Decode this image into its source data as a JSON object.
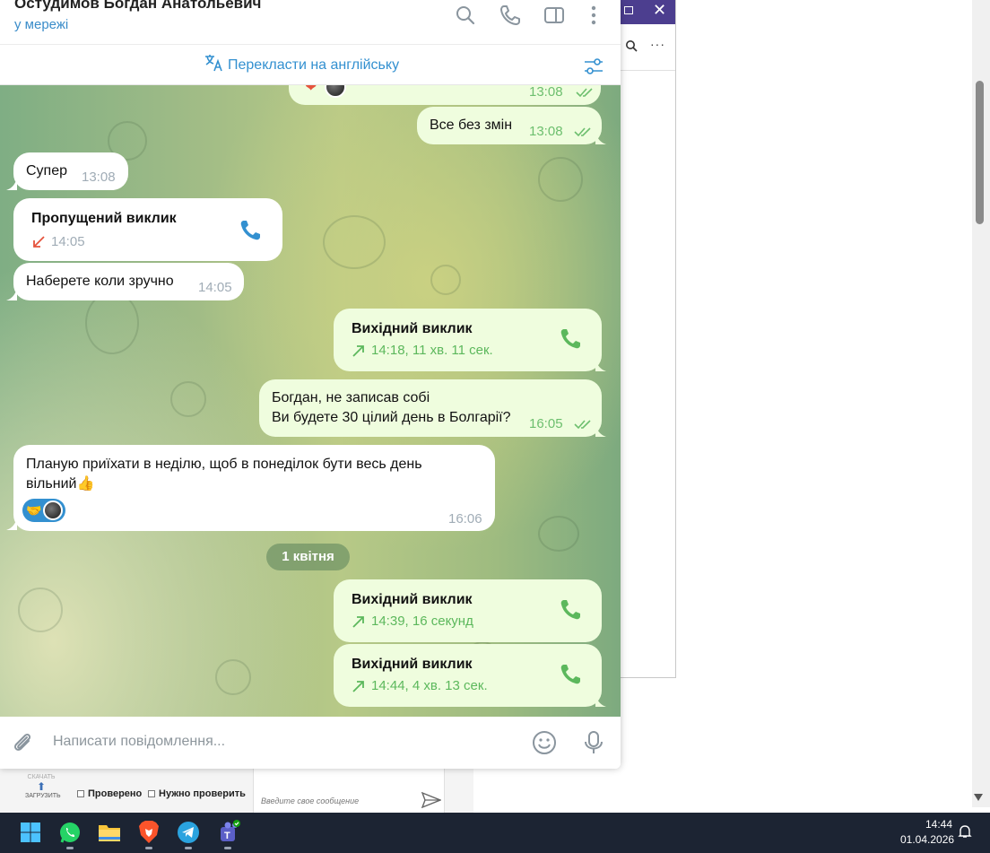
{
  "header": {
    "contact_name": "Остудимов Богдан Анатольевич",
    "status": "у мережі",
    "icons": [
      "search-icon",
      "phone-icon",
      "sidebar-toggle-icon",
      "more-vertical-icon"
    ]
  },
  "translate_bar": {
    "label": "Перекласти на англійську",
    "icon": "translate-icon",
    "settings_icon": "translate-settings-icon"
  },
  "messages": [
    {
      "dir": "out",
      "type": "reaction-partial",
      "time": "13:08",
      "read": true
    },
    {
      "dir": "out",
      "type": "text",
      "text": "Все без змін",
      "time": "13:08",
      "read": true
    },
    {
      "dir": "in",
      "type": "text",
      "text": "Супер",
      "time": "13:08"
    },
    {
      "dir": "in",
      "type": "call",
      "title": "Пропущений виклик",
      "meta": "14:05",
      "call_kind": "missed"
    },
    {
      "dir": "in",
      "type": "text",
      "text": "Наберете коли зручно",
      "time": "14:05"
    },
    {
      "dir": "out",
      "type": "call",
      "title": "Вихідний виклик",
      "meta": "14:18, 11 хв. 11 сек.",
      "call_kind": "outgoing"
    },
    {
      "dir": "out",
      "type": "text",
      "lines": [
        "Богдан, не записав собі",
        "Ви будете 30 цілий день в Болгарії?"
      ],
      "time": "16:05",
      "read": true
    },
    {
      "dir": "in",
      "type": "text",
      "lines": [
        "Планую приїхати в неділю, щоб в понеділок бути весь день",
        "вільний👍"
      ],
      "time": "16:06",
      "reaction": "🤝"
    },
    {
      "type": "date",
      "text": "1 квітня"
    },
    {
      "dir": "out",
      "type": "call",
      "title": "Вихідний виклик",
      "meta": "14:39, 16 секунд",
      "call_kind": "outgoing"
    },
    {
      "dir": "out",
      "type": "call",
      "title": "Вихідний виклик",
      "meta": "14:44, 4 хв. 13 сек.",
      "call_kind": "outgoing"
    }
  ],
  "composer": {
    "placeholder": "Написати повідомлення...",
    "icons": [
      "attach-icon",
      "emoji-icon",
      "microphone-icon"
    ]
  },
  "background_app": {
    "upload_label": "ЗАГРУЗИТЬ",
    "upload_caption": "СКАЧАТЬ",
    "checkbox_1": "Проверено",
    "checkbox_2": "Нужно проверить",
    "message_placeholder": "Введите свое сообщение"
  },
  "taskbar": {
    "apps": [
      "windows-start-icon",
      "whatsapp-icon",
      "file-explorer-icon",
      "brave-browser-icon",
      "telegram-icon",
      "teams-icon"
    ],
    "time": "14:44",
    "date": "01.04.2026"
  },
  "colors": {
    "accent": "#3390d0",
    "outgoing_bubble": "#effdde",
    "incoming_bubble": "#ffffff",
    "outgoing_meta": "#5cb85c",
    "missed_call": "#e5533d",
    "taskbar": "#1c2433"
  }
}
